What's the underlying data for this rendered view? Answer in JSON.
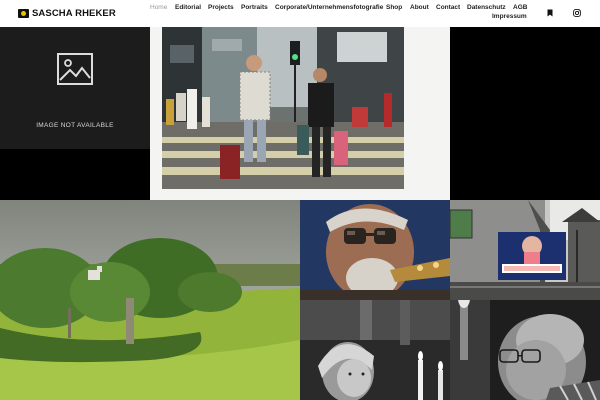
{
  "site": {
    "logo_text": "SASCHA RHEKER",
    "logo_icon": "camera-logo-icon"
  },
  "nav": {
    "items": [
      {
        "label": "Home",
        "active": true
      },
      {
        "label": "Editorial"
      },
      {
        "label": "Projects"
      },
      {
        "label": "Portraits"
      },
      {
        "label": "Corporate/Unternehmensfotografie"
      },
      {
        "label": "Shop"
      },
      {
        "label": "About"
      },
      {
        "label": "Contact"
      },
      {
        "label": "Datenschutz"
      },
      {
        "label": "AGB"
      },
      {
        "label": "Impressum"
      }
    ],
    "icons": [
      "bookmark-icon",
      "instagram-icon"
    ]
  },
  "gallery": {
    "placeholder_text": "IMAGE NOT AVAILABLE",
    "placeholder_icon": "image-placeholder-icon",
    "tiles": [
      "image-not-available",
      "street-crossing-photo",
      "black-tile",
      "green-river-landscape-photo",
      "saxophone-player-portrait-photo",
      "election-poster-street-photo",
      "church-candles-girl-photo",
      "church-candles-man-photo"
    ]
  },
  "colors": {
    "logo_accent": "#e6c400",
    "nav_active": "#9a9a9a",
    "nav_text": "#222222"
  }
}
